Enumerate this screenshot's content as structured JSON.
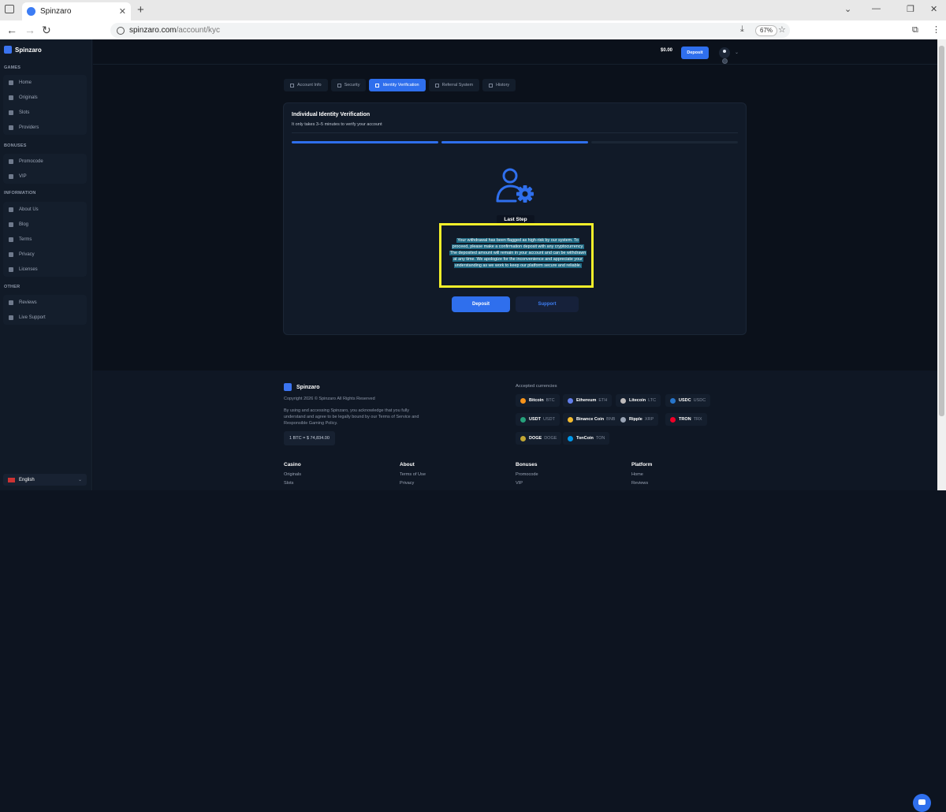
{
  "browser": {
    "tab_title": "Spinzaro",
    "url_host": "spinzaro.com",
    "url_path": "/account/kyc",
    "zoom": "67%"
  },
  "sidebar": {
    "brand": "Spinzaro",
    "sections": [
      {
        "title": "GAMES",
        "items": [
          "Home",
          "Originals",
          "Slots",
          "Providers"
        ]
      },
      {
        "title": "BONUSES",
        "items": [
          "Promocode",
          "VIP"
        ]
      },
      {
        "title": "INFORMATION",
        "items": [
          "About Us",
          "Blog",
          "Terms",
          "Privacy",
          "Licenses"
        ]
      },
      {
        "title": "OTHER",
        "items": [
          "Reviews",
          "Live Support"
        ]
      }
    ],
    "language": "English"
  },
  "header": {
    "balance": "$0.00",
    "deposit_label": "Deposit"
  },
  "account_tabs": [
    {
      "label": "Account Info",
      "active": false
    },
    {
      "label": "Security",
      "active": false
    },
    {
      "label": "Identity Verification",
      "active": true
    },
    {
      "label": "Referral System",
      "active": false
    },
    {
      "label": "History",
      "active": false
    }
  ],
  "kyc": {
    "title": "Individual Identity Verification",
    "subtitle": "It only takes 3–5 minutes to verify your account",
    "steps_completed": 2,
    "steps_total": 3,
    "step_label": "Last Step",
    "message": "Your withdrawal has been flagged as high-risk by our system. To proceed, please make a confirmation deposit with any cryptocurrency. The deposited amount will remain in your account and can be withdrawn at any time. We apologize for the inconvenience and appreciate your understanding as we work to keep our platform secure and reliable.",
    "deposit_label": "Deposit",
    "support_label": "Support"
  },
  "footer": {
    "brand": "Spinzaro",
    "copyright": "Copyright 2026 © Spinzaro All Rights Reserved",
    "disclaimer": "By using and accessing Spinzaro, you acknowledge that you fully understand and agree to be legally bound by our Terms of Service and Responsible Gaming Policy.",
    "btc_rate": "1 BTC = $ 74,834.00",
    "accepted_title": "Accepted currencies",
    "currencies": [
      {
        "name": "Bitcoin",
        "ticker": "BTC",
        "color": "#f7931a"
      },
      {
        "name": "Ethereum",
        "ticker": "ETH",
        "color": "#627eea"
      },
      {
        "name": "Litecoin",
        "ticker": "LTC",
        "color": "#bfbbbb"
      },
      {
        "name": "USDC",
        "ticker": "USDC",
        "color": "#2775ca"
      },
      {
        "name": "USDT",
        "ticker": "USDT",
        "color": "#26a17b"
      },
      {
        "name": "Binance Coin",
        "ticker": "BNB",
        "color": "#f3ba2f"
      },
      {
        "name": "Ripple",
        "ticker": "XRP",
        "color": "#9aa4b5"
      },
      {
        "name": "TRON",
        "ticker": "TRX",
        "color": "#ef0027"
      },
      {
        "name": "DOGE",
        "ticker": "DOGE",
        "color": "#c2a633"
      },
      {
        "name": "TonCoin",
        "ticker": "TON",
        "color": "#0098ea"
      }
    ],
    "columns": [
      {
        "title": "Casino",
        "links": [
          "Originals",
          "Slots"
        ]
      },
      {
        "title": "About",
        "links": [
          "Terms of Use",
          "Privacy"
        ]
      },
      {
        "title": "Bonuses",
        "links": [
          "Promocode",
          "VIP"
        ]
      },
      {
        "title": "Platform",
        "links": [
          "Home",
          "Reviews"
        ]
      }
    ]
  },
  "colors": {
    "accent": "#2f6fed",
    "highlight": "#f4ef2a",
    "background": "#0b111b"
  }
}
